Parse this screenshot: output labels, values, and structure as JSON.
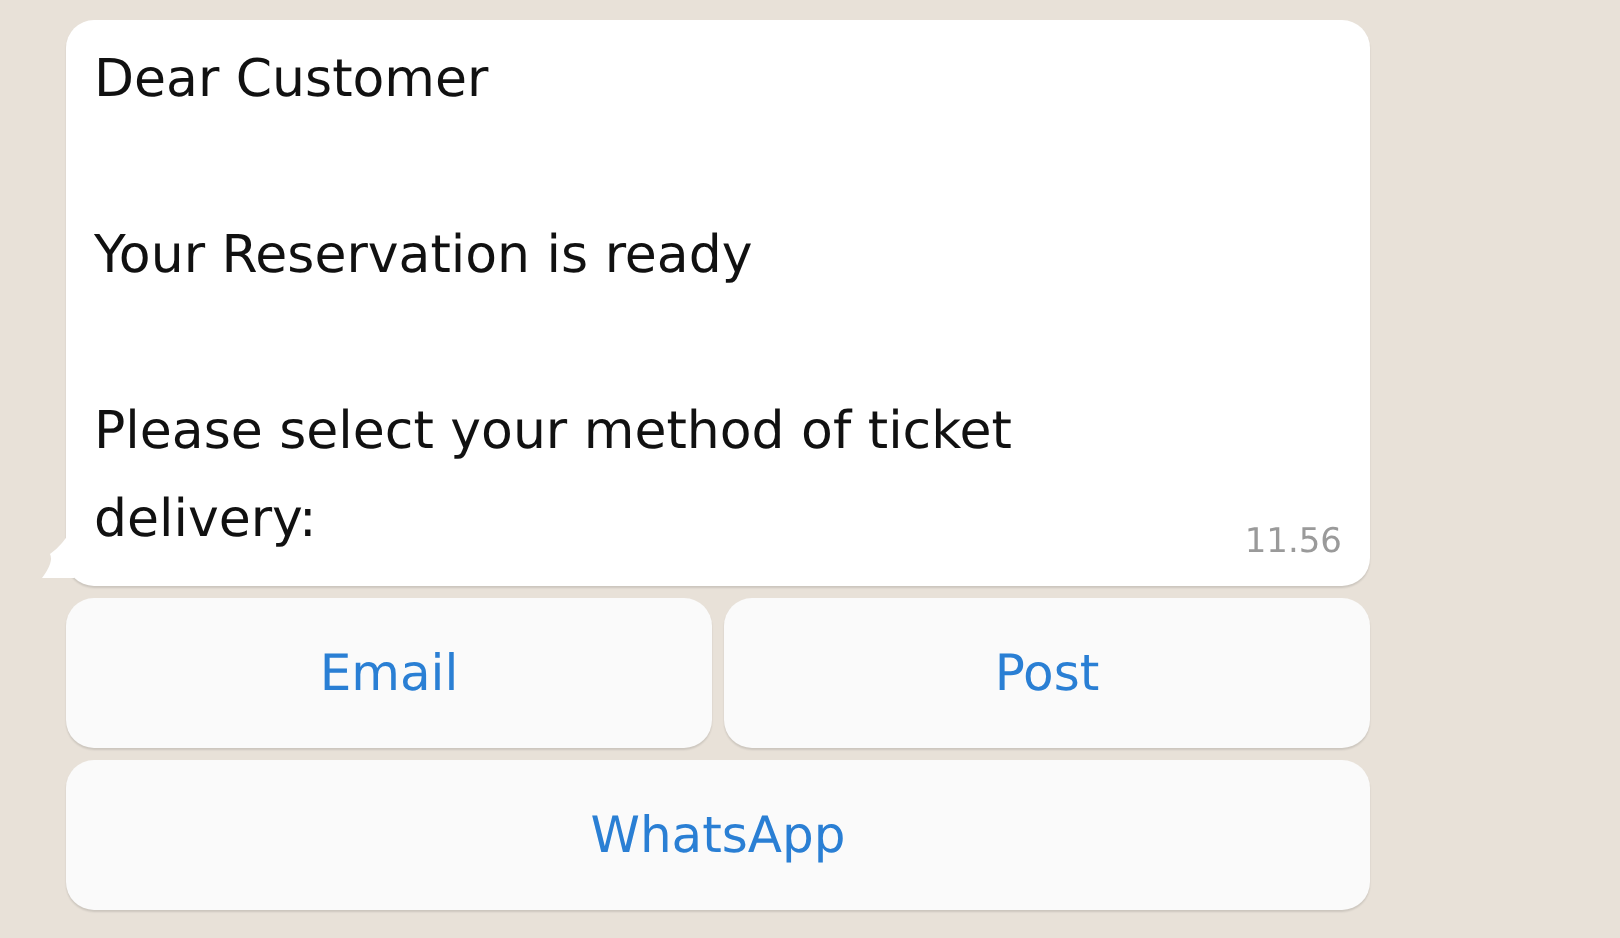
{
  "message": {
    "paragraphs": [
      "Dear Customer",
      "Your Reservation is ready",
      "Please select your method of ticket delivery:"
    ],
    "time": "11.56"
  },
  "button_rows": [
    [
      {
        "label": "Email"
      },
      {
        "label": "Post"
      }
    ],
    [
      {
        "label": "WhatsApp"
      }
    ]
  ]
}
